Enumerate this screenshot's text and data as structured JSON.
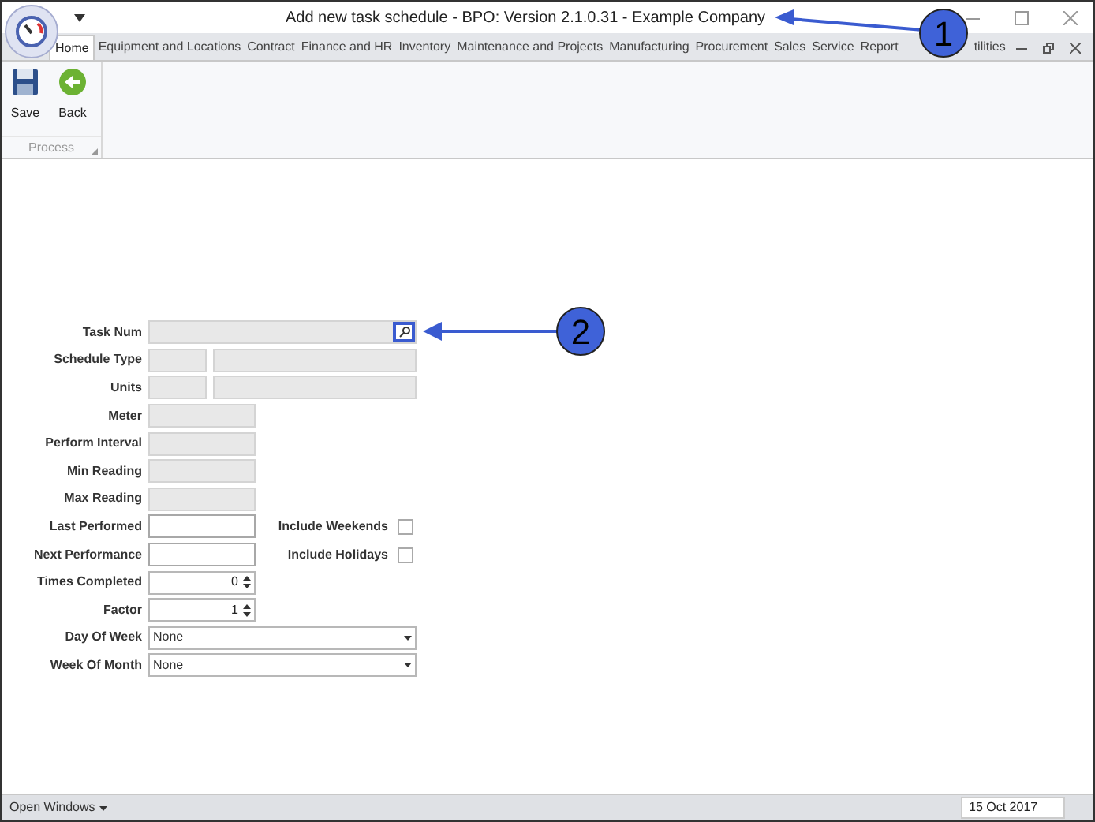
{
  "window": {
    "title": "Add new task schedule - BPO: Version 2.1.0.31 - Example Company"
  },
  "tabs": [
    {
      "label": "Home",
      "selected": true
    },
    {
      "label": "Equipment and Locations",
      "selected": false
    },
    {
      "label": "Contract",
      "selected": false
    },
    {
      "label": "Finance and HR",
      "selected": false
    },
    {
      "label": "Inventory",
      "selected": false
    },
    {
      "label": "Maintenance and Projects",
      "selected": false
    },
    {
      "label": "Manufacturing",
      "selected": false
    },
    {
      "label": "Procurement",
      "selected": false
    },
    {
      "label": "Sales",
      "selected": false
    },
    {
      "label": "Service",
      "selected": false
    },
    {
      "label": "Report",
      "selected": false
    },
    {
      "label": "tilities",
      "selected": false
    }
  ],
  "ribbon": {
    "buttons": [
      {
        "label": "Save",
        "kind": "save"
      },
      {
        "label": "Back",
        "kind": "back"
      }
    ],
    "group": "Process"
  },
  "form": [
    {
      "label": "Task Num",
      "kind": "lookup",
      "disabled": true
    },
    {
      "label": "Schedule Type",
      "kind": "pair",
      "disabled": true
    },
    {
      "label": "Units",
      "kind": "pair",
      "disabled": true
    },
    {
      "label": "Meter",
      "kind": "text",
      "disabled": true
    },
    {
      "label": "Perform Interval",
      "kind": "text",
      "disabled": true
    },
    {
      "label": "Min Reading",
      "kind": "text",
      "disabled": true
    },
    {
      "label": "Max Reading",
      "kind": "text",
      "disabled": true
    },
    {
      "label": "Last Performed",
      "kind": "text",
      "disabled": false,
      "check": {
        "label": "Include Weekends",
        "checked": false
      }
    },
    {
      "label": "Next Performance",
      "kind": "text",
      "disabled": false,
      "check": {
        "label": "Include Holidays",
        "checked": false
      }
    },
    {
      "label": "Times Completed",
      "kind": "spin",
      "value": "0"
    },
    {
      "label": "Factor",
      "kind": "spin",
      "value": "1"
    },
    {
      "label": "Day Of Week",
      "kind": "select",
      "value": "None"
    },
    {
      "label": "Week Of Month",
      "kind": "select",
      "value": "None"
    }
  ],
  "callouts": [
    "1",
    "2"
  ],
  "status_bar": {
    "windows": "Open Windows",
    "date": "15 Oct 2017"
  }
}
